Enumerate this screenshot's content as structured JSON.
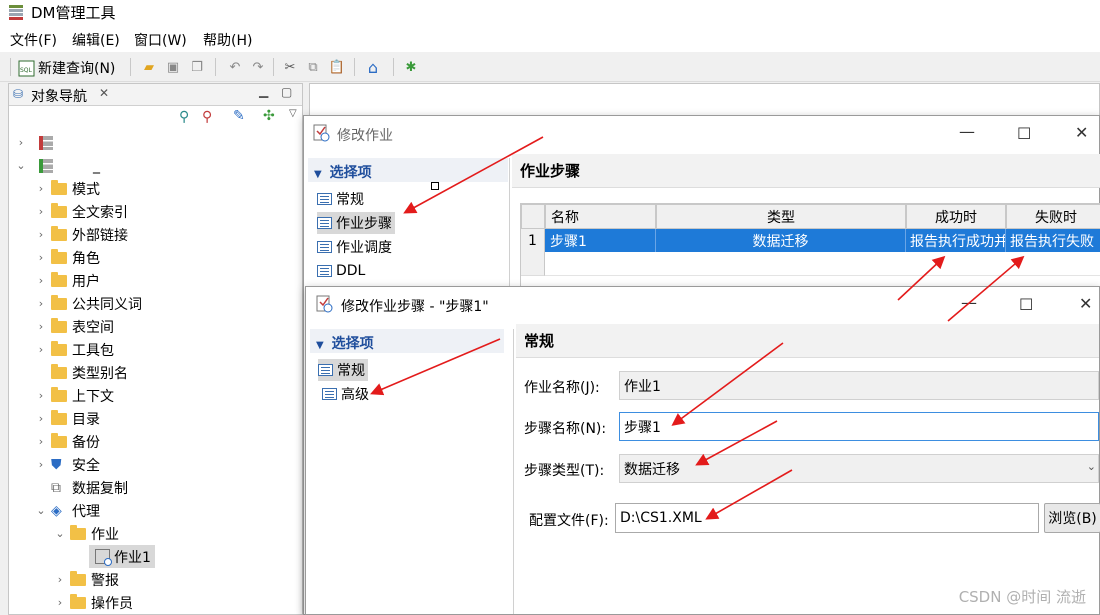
{
  "app": {
    "title": "DM管理工具"
  },
  "menu": {
    "file": "文件(F)",
    "edit": "编辑(E)",
    "window": "窗口(W)",
    "help": "帮助(H)"
  },
  "toolbar": {
    "new_query": "新建查询(N)"
  },
  "navigator": {
    "tab_label": "对象导航",
    "root_name": "_",
    "items": {
      "schema": "模式",
      "fulltext": "全文索引",
      "dblink": "外部链接",
      "role": "角色",
      "user": "用户",
      "synonym": "公共同义词",
      "tablespace": "表空间",
      "package": "工具包",
      "type_alias": "类型别名",
      "context": "上下文",
      "directory": "目录",
      "backup": "备份",
      "security": "安全",
      "replication": "数据复制",
      "agent": "代理",
      "job": "作业",
      "job1": "作业1",
      "alert": "警报",
      "operator": "操作员"
    }
  },
  "job_dialog": {
    "title": "修改作业",
    "options_header": "选择项",
    "options": {
      "general": "常规",
      "steps": "作业步骤",
      "schedule": "作业调度",
      "ddl": "DDL"
    },
    "section_title": "作业步骤",
    "columns": {
      "name": "名称",
      "type": "类型",
      "on_success": "成功时",
      "on_failure": "失败时"
    },
    "row": {
      "index": "1",
      "name": "步骤1",
      "type": "数据迁移",
      "on_success": "报告执行成功并",
      "on_failure": "报告执行失败"
    }
  },
  "step_dialog": {
    "title": "修改作业步骤 - \"步骤1\"",
    "options_header": "选择项",
    "options": {
      "general": "常规",
      "advanced": "高级"
    },
    "section_title": "常规",
    "labels": {
      "job_name": "作业名称(J):",
      "step_name": "步骤名称(N):",
      "step_type": "步骤类型(T):",
      "config_file": "配置文件(F):"
    },
    "values": {
      "job_name": "作业1",
      "step_name": "步骤1",
      "step_type": "数据迁移",
      "config_file": "D:\\CS1.XML"
    },
    "browse": "浏览(B)"
  },
  "watermark": "CSDN @时间 流逝",
  "colors": {
    "selection": "#1e7ad8",
    "accent": "#1f4e9c",
    "arrow": "#e31b1b"
  }
}
